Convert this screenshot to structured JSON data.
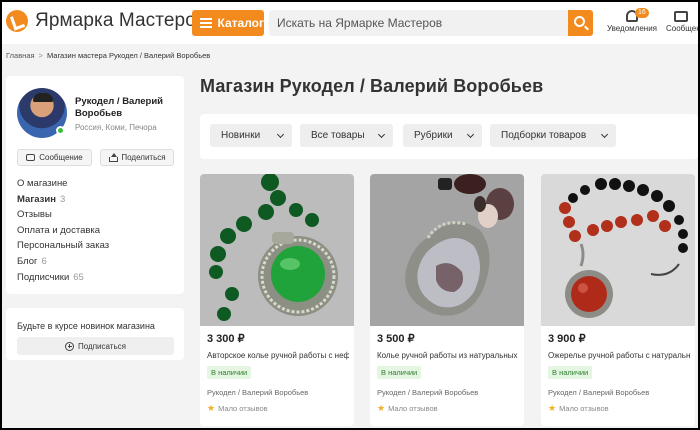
{
  "header": {
    "logo_text": "Ярмарка Мастеров",
    "catalog_label": "Каталог",
    "search_placeholder": "Искать на Ярмарке Мастеров",
    "notifications_label": "Уведомления",
    "notifications_count": "16",
    "messages_label": "Сообщени"
  },
  "breadcrumb": {
    "home": "Главная",
    "separator": ">",
    "current": "Магазин мастера Рукодел / Валерий Воробьев"
  },
  "sidebar": {
    "shop_name": "Рукодел / Валерий Воробьев",
    "location": "Россия, Коми, Печора",
    "message_button": "Сообщение",
    "share_button": "Поделиться",
    "nav": [
      {
        "label": "О магазине",
        "count": ""
      },
      {
        "label": "Магазин",
        "count": "3"
      },
      {
        "label": "Отзывы",
        "count": ""
      },
      {
        "label": "Оплата и доставка",
        "count": ""
      },
      {
        "label": "Персональный заказ",
        "count": ""
      },
      {
        "label": "Блог",
        "count": "6"
      },
      {
        "label": "Подписчики",
        "count": "65"
      }
    ],
    "subscribe_title": "Будьте в курсе новинок магазина",
    "subscribe_button": "Подписаться"
  },
  "main": {
    "title": "Магазин Рукодел / Валерий Воробьев",
    "filters": [
      "Новинки",
      "Все товары",
      "Рубрики",
      "Подборки товаров"
    ]
  },
  "products": [
    {
      "price": "3 300 ₽",
      "description": "Авторское колье ручной работы с нефритом",
      "availability": "В наличии",
      "seller": "Рукодел / Валерий Воробьев",
      "reviews": "Мало отзывов",
      "stone_color": "#1fa33a"
    },
    {
      "price": "3 500 ₽",
      "description": "Колье ручной работы из натуральных камней",
      "availability": "В наличии",
      "seller": "Рукодел / Валерий Воробьев",
      "reviews": "Мало отзывов",
      "stone_color": "#bdbdc6"
    },
    {
      "price": "3 900 ₽",
      "description": "Ожерелье ручной работы с натуральными камнями",
      "availability": "В наличии",
      "seller": "Рукодел / Валерий Воробьев",
      "reviews": "Мало отзывов",
      "stone_color": "#b02a1a"
    }
  ],
  "colors": {
    "accent": "#f28a1e",
    "availability_bg": "#e4f6e2",
    "availability_text": "#2e7d2e"
  }
}
